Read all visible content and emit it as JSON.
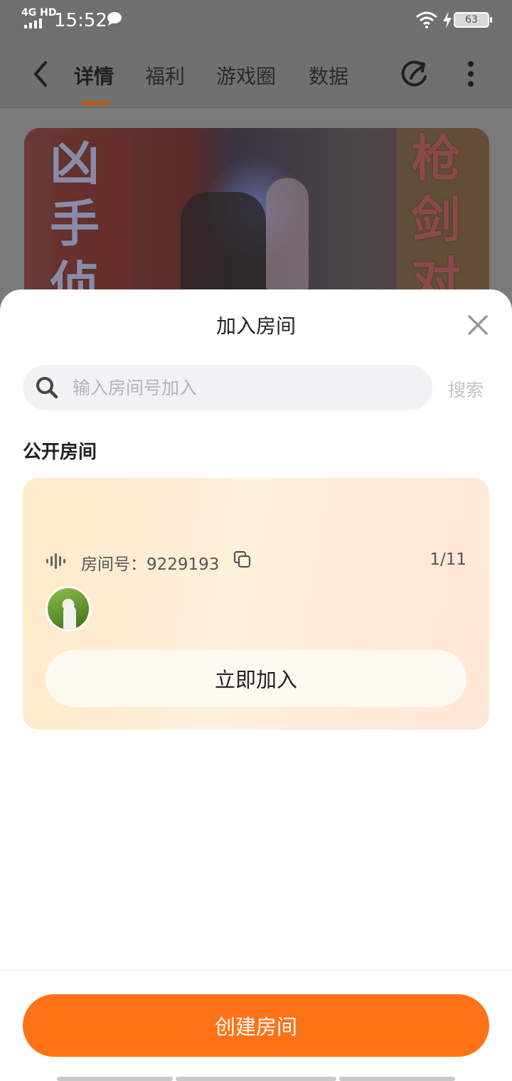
{
  "status_bar": {
    "network": "4G HD",
    "time": "15:52",
    "battery": "63"
  },
  "nav": {
    "tabs": [
      "详情",
      "福利",
      "游戏圈",
      "数据"
    ],
    "active_tab": "详情"
  },
  "banner": {
    "left_text": "凶手侦",
    "right_text": "枪剑对"
  },
  "sheet": {
    "title": "加入房间",
    "search": {
      "placeholder": "输入房间号加入",
      "value": "",
      "button_label": "搜索"
    },
    "section_title": "公开房间",
    "room": {
      "room_label": "房间号：9229193",
      "count": "1/11",
      "join_label": "立即加入"
    },
    "create_label": "创建房间"
  },
  "colors": {
    "accent": "#ff7316",
    "card_gradient_start": "#ffe9c8",
    "card_gradient_end": "#ffe6d6"
  }
}
